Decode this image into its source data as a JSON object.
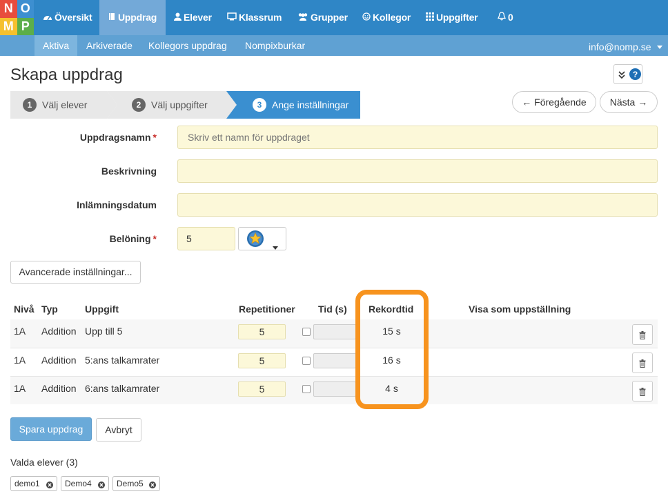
{
  "logo": {
    "letters": [
      "N",
      "O",
      "M",
      "P"
    ],
    "colors": [
      "#e84c3d",
      "#3d8fd0",
      "#f5c02e",
      "#5cae4a"
    ]
  },
  "nav": {
    "items": [
      {
        "label": "Översikt",
        "icon": "dashboard-icon"
      },
      {
        "label": "Uppdrag",
        "icon": "book-icon"
      },
      {
        "label": "Elever",
        "icon": "user-icon"
      },
      {
        "label": "Klassrum",
        "icon": "monitor-icon"
      },
      {
        "label": "Grupper",
        "icon": "users-icon"
      },
      {
        "label": "Kollegor",
        "icon": "smile-icon"
      },
      {
        "label": "Uppgifter",
        "icon": "grid-icon"
      },
      {
        "label": "0",
        "icon": "bell-icon"
      }
    ],
    "active": "Uppdrag"
  },
  "subnav": {
    "items": [
      "Aktiva",
      "Arkiverade",
      "Kollegors uppdrag",
      "Nompixburkar"
    ],
    "account": "info@nomp.se"
  },
  "page": {
    "title": "Skapa uppdrag"
  },
  "wizard": {
    "steps": [
      {
        "num": "1",
        "label": "Välj elever"
      },
      {
        "num": "2",
        "label": "Välj uppgifter"
      },
      {
        "num": "3",
        "label": "Ange inställningar"
      }
    ],
    "prev": "← Föregående",
    "next": "Nästa →"
  },
  "form": {
    "name_label": "Uppdragsnamn",
    "name_placeholder": "Skriv ett namn för uppdraget",
    "desc_label": "Beskrivning",
    "date_label": "Inlämningsdatum",
    "reward_label": "Belöning",
    "reward_value": "5",
    "required_mark": "*",
    "advanced": "Avancerade inställningar..."
  },
  "table": {
    "headers": [
      "Nivå",
      "Typ",
      "Uppgift",
      "Repetitioner",
      "Tid (s)",
      "Rekordtid",
      "Visa som uppställning"
    ],
    "rows": [
      {
        "level": "1A",
        "type": "Addition",
        "task": "Upp till 5",
        "reps": "5",
        "record": "15 s"
      },
      {
        "level": "1A",
        "type": "Addition",
        "task": "5:ans talkamrater",
        "reps": "5",
        "record": "16 s"
      },
      {
        "level": "1A",
        "type": "Addition",
        "task": "6:ans talkamrater",
        "reps": "5",
        "record": "4 s"
      }
    ]
  },
  "actions": {
    "save": "Spara uppdrag",
    "cancel": "Avbryt"
  },
  "students": {
    "title": "Valda elever (3)",
    "chips": [
      "demo1",
      "Demo4",
      "Demo5"
    ]
  },
  "colors": {
    "nav_bg": "#2f86c6",
    "highlight": "#f7931e",
    "field_bg": "#fcf8d9"
  }
}
